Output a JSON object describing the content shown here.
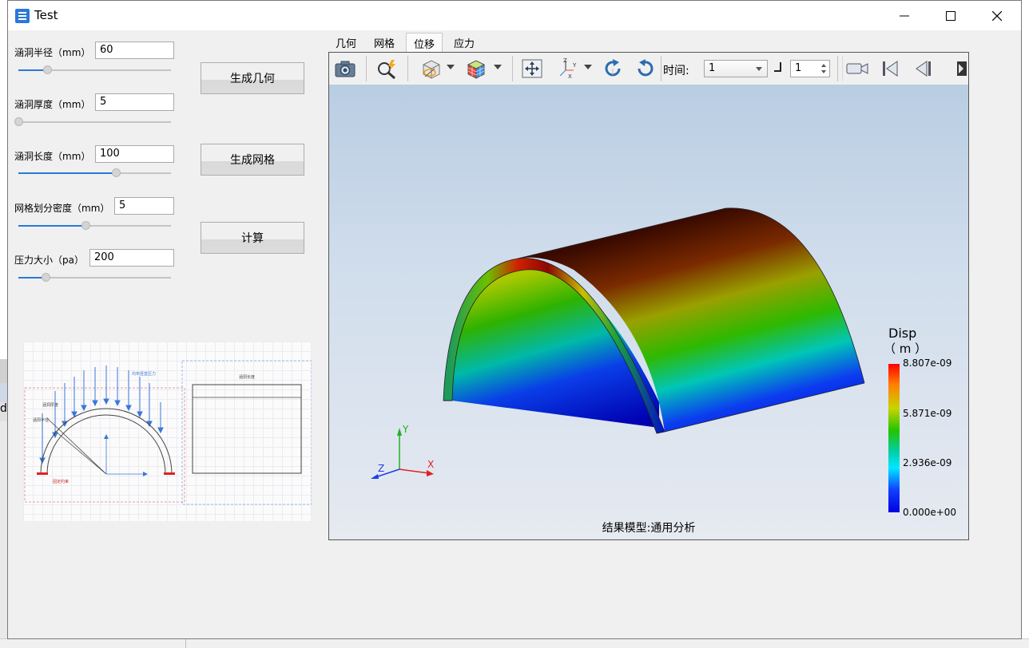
{
  "window": {
    "title": "Test"
  },
  "controls": {
    "radius": {
      "label": "涵洞半径（mm）",
      "value": "60",
      "slider": 0.19
    },
    "thickness": {
      "label": "涵洞厚度（mm）",
      "value": "5",
      "slider": 0.0
    },
    "length": {
      "label": "涵洞长度（mm）",
      "value": "100",
      "slider": 0.64
    },
    "mesh_density": {
      "label": "网格划分密度（mm）",
      "value": "5",
      "slider": 0.44
    },
    "pressure": {
      "label": "压力大小（pa）",
      "value": "200",
      "slider": 0.18
    }
  },
  "buttons": {
    "geometry": "生成几何",
    "mesh": "生成网格",
    "compute": "计算"
  },
  "sketch": {
    "load_label": "均布竖直压力",
    "thickness_label": "涵洞厚度",
    "radius_label": "涵洞半径",
    "support_label": "固定约束",
    "length_label": "涵洞长度"
  },
  "tabs": [
    {
      "label": "几何",
      "active": false
    },
    {
      "label": "网格",
      "active": false
    },
    {
      "label": "位移",
      "active": true
    },
    {
      "label": "应力",
      "active": false
    }
  ],
  "toolbar": {
    "time_label": "时间:",
    "time_value": "1",
    "step_value": "1",
    "icons": [
      "camera-icon",
      "probe-icon",
      "display-mode-icon",
      "color-map-icon",
      "fit-view-icon",
      "axes-orientation-icon",
      "rotate-cw-icon",
      "rotate-ccw-icon",
      "record-video-icon",
      "first-frame-icon",
      "previous-frame-icon",
      "next-frame-icon"
    ]
  },
  "legend": {
    "title": "Disp",
    "unit": "（ m ）",
    "values": [
      "8.807e-09",
      "5.871e-09",
      "2.936e-09",
      "0.000e+00"
    ]
  },
  "axes": {
    "x": "X",
    "y": "Y",
    "z": "Z"
  },
  "caption": "结果模型:通用分析",
  "colors": {
    "accent": "#2a78d6",
    "legend_max": "#ff0000",
    "legend_min": "#0000e0"
  }
}
